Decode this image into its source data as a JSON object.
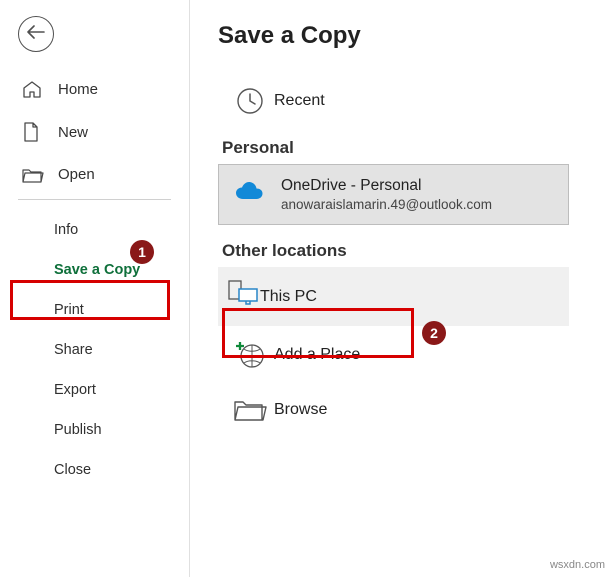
{
  "page_title": "Save a Copy",
  "sidebar": {
    "top": [
      {
        "label": "Home"
      },
      {
        "label": "New"
      },
      {
        "label": "Open"
      }
    ],
    "bottom": [
      {
        "label": "Info"
      },
      {
        "label": "Save a Copy",
        "active": true
      },
      {
        "label": "Print"
      },
      {
        "label": "Share"
      },
      {
        "label": "Export"
      },
      {
        "label": "Publish"
      },
      {
        "label": "Close"
      }
    ]
  },
  "locations": {
    "recent": {
      "label": "Recent"
    },
    "personal_header": "Personal",
    "onedrive": {
      "title": "OneDrive - Personal",
      "email": "anowaraislamarin.49@outlook.com"
    },
    "other_header": "Other locations",
    "this_pc": {
      "label": "This PC"
    },
    "add_place": {
      "label": "Add a Place"
    },
    "browse": {
      "label": "Browse"
    }
  },
  "callouts": {
    "one": "1",
    "two": "2"
  },
  "watermark": "wsxdn.com"
}
